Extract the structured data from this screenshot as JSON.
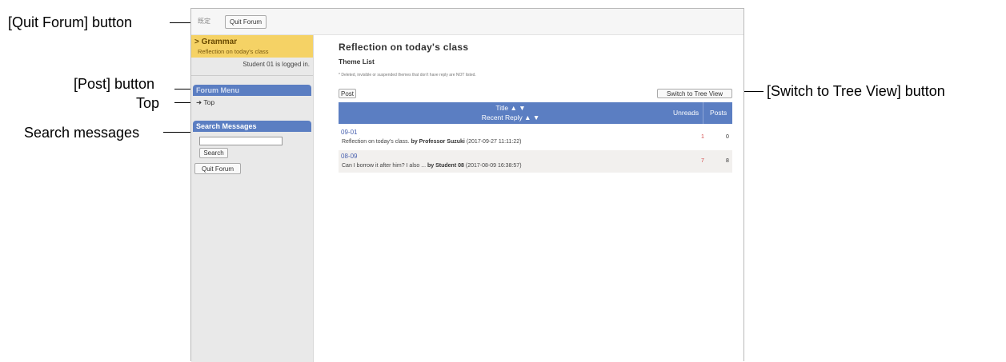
{
  "callouts": {
    "quit_forum": "[Quit Forum] button",
    "post": "[Post]  button",
    "top": "Top",
    "search": "Search messages",
    "tree_view": "[Switch to Tree View] button"
  },
  "topbar": {
    "kanji": "既定",
    "quit_label": "Quit Forum"
  },
  "sidebar": {
    "course_name": "> Grammar",
    "course_sub": "Reflection on today's class",
    "logged_in": "Student 01 is logged in.",
    "forum_menu": "Forum Menu",
    "menu_items": [
      {
        "label": "Top"
      }
    ],
    "search_heading": "Search Messages",
    "search_button": "Search",
    "quit_label": "Quit Forum"
  },
  "main": {
    "title": "Reflection on today's class",
    "theme_list": "Theme List",
    "note": "* Deleted, invisible or suspended themes that don't have reply are NOT listed.",
    "post_label": "Post",
    "tree_label": "Switch to Tree View",
    "table": {
      "title_header": "Title ▲ ▼",
      "reply_header": "Recent Reply ▲ ▼",
      "unreads_header": "Unreads",
      "posts_header": "Posts"
    },
    "rows": [
      {
        "number": "09-01",
        "text": "Reflection on today's class.",
        "by": "by Professor Suzuki",
        "date": "(2017-09-27 11:11:22)",
        "unreads": "1",
        "posts": "0"
      },
      {
        "number": "08-09",
        "text": "Can I borrow it after him? I also ...",
        "by": "by Student 08",
        "date": "(2017-08-09 16:38:57)",
        "unreads": "7",
        "posts": "8"
      }
    ]
  },
  "colors": {
    "header_blue": "#5b7ec2",
    "course_yellow": "#f5d265",
    "unread_red": "#d24b4b"
  }
}
